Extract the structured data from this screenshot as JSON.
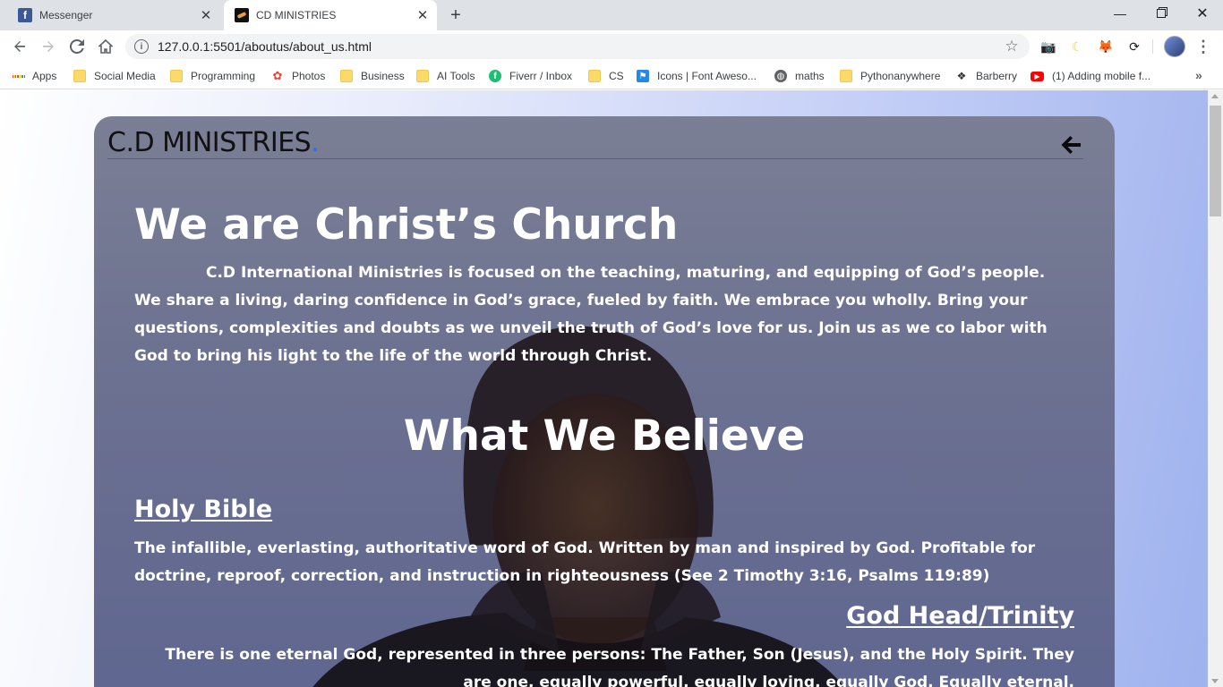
{
  "browser": {
    "tabs": [
      {
        "title": "Messenger",
        "favicon": "facebook-icon",
        "active": false
      },
      {
        "title": "CD MINISTRIES",
        "favicon": "cd-ministries-icon",
        "active": true
      }
    ],
    "new_tab": "+",
    "url": "127.0.0.1:5501/aboutus/about_us.html",
    "bookmarks": [
      {
        "label": "Apps",
        "icon": "apps-grid-icon"
      },
      {
        "label": "Social Media",
        "icon": "folder-icon"
      },
      {
        "label": "Programming",
        "icon": "folder-icon"
      },
      {
        "label": "Photos",
        "icon": "photos-icon"
      },
      {
        "label": "Business",
        "icon": "folder-icon"
      },
      {
        "label": "AI Tools",
        "icon": "folder-icon"
      },
      {
        "label": "Fiverr / Inbox",
        "icon": "fiverr-icon"
      },
      {
        "label": "CS",
        "icon": "folder-icon"
      },
      {
        "label": "Icons | Font Aweso...",
        "icon": "font-awesome-icon"
      },
      {
        "label": "maths",
        "icon": "globe-icon"
      },
      {
        "label": "Pythonanywhere",
        "icon": "folder-icon"
      },
      {
        "label": "Barberry",
        "icon": "barberry-icon"
      },
      {
        "label": "(1) Adding mobile f...",
        "icon": "youtube-icon"
      }
    ]
  },
  "page": {
    "brand": "C.D MINISTRIES",
    "brand_dot": ".",
    "heading": "We are Christ’s Church",
    "intro": "C.D International Ministries is focused on the teaching, maturing, and equipping of God’s people. We share a living, daring confidence in God’s grace, fueled by faith. We embrace you wholly. Bring your questions, complexities and doubts as we unveil the truth of God’s love for us. Join us as we co labor with God to bring his light to the life of the world through Christ.",
    "beliefs_heading": "What We Believe",
    "beliefs": [
      {
        "title": "Holy Bible",
        "text": "The infallible, everlasting, authoritative word of God. Written by man and inspired by God. Profitable for doctrine, reproof, correction, and instruction in righteousness (See 2 Timothy 3:16, Psalms 119:89)"
      },
      {
        "title": "God Head/Trinity",
        "text": "There is one eternal God, represented in three persons: The Father, Son (Jesus), and the Holy Spirit. They are one, equally powerful, equally loving, equally God. Equally eternal."
      }
    ]
  },
  "colors": {
    "card_bg": "#6d7291",
    "brand_dot": "#2f6df0",
    "text": "#ffffff"
  }
}
